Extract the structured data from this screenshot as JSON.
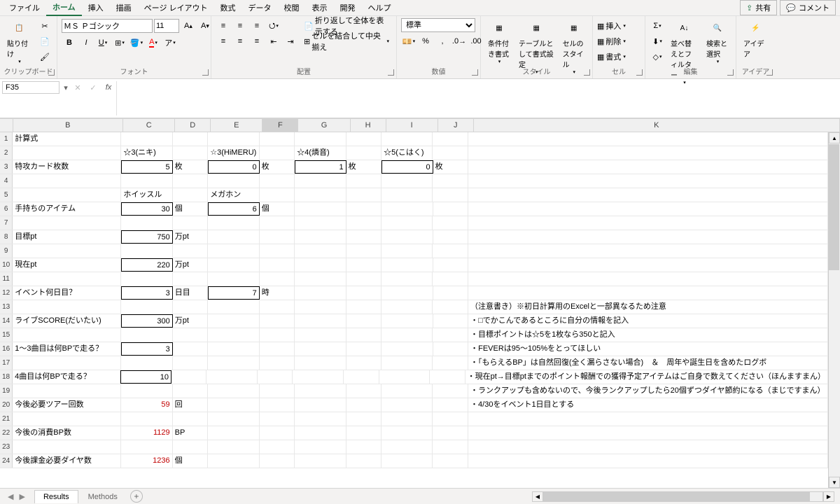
{
  "menu": {
    "file": "ファイル",
    "home": "ホーム",
    "insert": "挿入",
    "draw": "描画",
    "pagelayout": "ページ レイアウト",
    "formulas": "数式",
    "data": "データ",
    "review": "校閲",
    "view": "表示",
    "developer": "開発",
    "help": "ヘルプ",
    "share": "共有",
    "comments": "コメント"
  },
  "ribbon": {
    "clipboard": {
      "label": "クリップボード",
      "paste": "貼り付け"
    },
    "font": {
      "label": "フォント",
      "name": "ＭＳ Ｐゴシック",
      "size": "11"
    },
    "alignment": {
      "label": "配置",
      "wrap": "折り返して全体を表示する",
      "merge": "セルを結合して中央揃え"
    },
    "number": {
      "label": "数値",
      "format": "標準"
    },
    "styles": {
      "label": "スタイル",
      "conditional": "条件付き書式",
      "table": "テーブルとして書式設定",
      "cell": "セルのスタイル"
    },
    "cells": {
      "label": "セル",
      "insert": "挿入",
      "delete": "削除",
      "format": "書式"
    },
    "editing": {
      "label": "編集",
      "sort": "並べ替えとフィルター",
      "find": "検索と選択"
    },
    "ideas": {
      "label": "アイデア",
      "ideas": "アイデア"
    }
  },
  "namebox": "F35",
  "columns": [
    "B",
    "C",
    "D",
    "E",
    "F",
    "G",
    "H",
    "I",
    "J",
    "K"
  ],
  "rows": {
    "1": {
      "B": "計算式"
    },
    "2": {
      "C": "☆3(ニキ)",
      "E": "☆3(HiMERU)",
      "G": "☆4(燐音)",
      "I": "☆5(こはく)"
    },
    "3": {
      "B": "特攻カード枚数",
      "C": "5",
      "D": "枚",
      "E": "0",
      "F": "枚",
      "G": "1",
      "H": "枚",
      "I": "0",
      "J": "枚"
    },
    "5": {
      "C": "ホイッスル",
      "E": "メガホン"
    },
    "6": {
      "B": "手持ちのアイテム",
      "C": "30",
      "D": "個",
      "E": "6",
      "F": "個"
    },
    "8": {
      "B": "目標pt",
      "C": "750",
      "D": "万pt"
    },
    "10": {
      "B": "現在pt",
      "C": "220",
      "D": "万pt"
    },
    "12": {
      "B": "イベント何日目？",
      "C": "3",
      "D": "日目",
      "E": "7",
      "F": "時"
    },
    "13": {
      "K": "（注意書き）※初日計算用のExcelと一部異なるため注意"
    },
    "14": {
      "B": "ライブSCORE(だいたい)",
      "C": "300",
      "D": "万pt",
      "K": "・□でかこんであるところに自分の情報を記入"
    },
    "15": {
      "K": "・目標ポイントは☆5を1枚なら350と記入"
    },
    "16": {
      "B": "1～3曲目は何BPで走る？",
      "C": "3",
      "K": "・FEVERは95～105%をとってほしい"
    },
    "17": {
      "K": "・「もらえるBP」は自然回復(全く漏らさない場合)　＆　周年や誕生日を含めたログボ"
    },
    "18": {
      "B": "4曲目は何BPで走る？",
      "C": "10",
      "K": "・現在pt→目標ptまでのポイント報酬での獲得予定アイテムはご自身で数えてください（ほんますまん）"
    },
    "19": {
      "K": "・ランクアップも含めないので、今後ランクアップしたら20個ずつダイヤ節約になる（まじですまん）"
    },
    "20": {
      "B": "今後必要ツアー回数",
      "C": "59",
      "D": "回",
      "K": "・4/30をイベント1日目とする"
    },
    "22": {
      "B": "今後の消費BP数",
      "C": "1129",
      "D": "BP"
    },
    "24": {
      "B": "今後課金必要ダイヤ数",
      "C": "1236",
      "D": "個"
    }
  },
  "tabs": {
    "results": "Results",
    "methods": "Methods"
  }
}
